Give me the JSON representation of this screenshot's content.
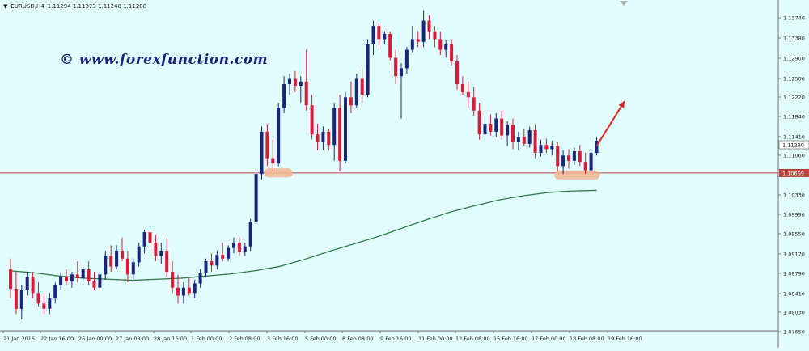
{
  "info_bar": {
    "arrow_icon": "triangle-down-icon",
    "symbol": "EURUSD,H4",
    "ohlc": "1.11294 1.11373 1.11240 1.11280"
  },
  "watermark": "© www.forexfunction.com",
  "colors": {
    "background": "#e2fdfd",
    "bull_candle": "#1a237e",
    "bear_candle": "#d81b3a",
    "moving_average": "#2e7d46",
    "support_line": "#b5453a",
    "highlight": "#f2b48f",
    "arrow": "#e52222",
    "axis": "#707070"
  },
  "chart_data": {
    "type": "candlestick",
    "symbol": "EURUSD",
    "timeframe": "H4",
    "ylim": [
      1.077,
      1.1385
    ],
    "y_ticks": [
      "1.13740",
      "1.13380",
      "1.12900",
      "1.12500",
      "1.12220",
      "1.11840",
      "1.11410",
      "1.11060",
      "1.10330",
      "1.09990",
      "1.09550",
      "1.09170",
      "1.08790",
      "1.08410",
      "1.08030",
      "1.07650"
    ],
    "x_ticks": [
      "21 Jan 2016",
      "22 Jan 16:00",
      "26 Jan 00:00",
      "27 Jan 08:00",
      "28 Jan 16:00",
      "1 Feb 00:00",
      "2 Feb 08:00",
      "3 Feb 16:00",
      "5 Feb 00:00",
      "8 Feb 08:00",
      "9 Feb 16:00",
      "11 Feb 00:00",
      "12 Feb 08:00",
      "15 Feb 16:00",
      "17 Feb 00:00",
      "18 Feb 08:00",
      "19 Feb 16:00"
    ],
    "current_price_label": "1.11280",
    "support_level": 1.10669,
    "support_label": "1.10669",
    "candles": [
      [
        1.0885,
        1.0905,
        1.083,
        1.0848
      ],
      [
        1.0848,
        1.088,
        1.08,
        1.081
      ],
      [
        1.081,
        1.0855,
        1.079,
        1.0845
      ],
      [
        1.0845,
        1.088,
        1.0835,
        1.087
      ],
      [
        1.087,
        1.088,
        1.083,
        1.084
      ],
      [
        1.084,
        1.086,
        1.0815,
        1.082
      ],
      [
        1.082,
        1.084,
        1.08,
        1.081
      ],
      [
        1.081,
        1.084,
        1.08,
        1.083
      ],
      [
        1.083,
        1.086,
        1.082,
        1.0855
      ],
      [
        1.0855,
        1.088,
        1.0845,
        1.087
      ],
      [
        1.087,
        1.0885,
        1.0855,
        1.0862
      ],
      [
        1.0862,
        1.088,
        1.085,
        1.0875
      ],
      [
        1.0875,
        1.09,
        1.086,
        1.0868
      ],
      [
        1.0868,
        1.089,
        1.086,
        1.0885
      ],
      [
        1.0885,
        1.09,
        1.0855,
        1.0862
      ],
      [
        1.0862,
        1.088,
        1.0845,
        1.085
      ],
      [
        1.085,
        1.088,
        1.0845,
        1.0875
      ],
      [
        1.0875,
        1.092,
        1.0865,
        1.091
      ],
      [
        1.091,
        1.093,
        1.088,
        1.089
      ],
      [
        1.089,
        1.093,
        1.0885,
        1.092
      ],
      [
        1.092,
        1.0945,
        1.09,
        1.0905
      ],
      [
        1.0905,
        1.092,
        1.086,
        1.0875
      ],
      [
        1.0875,
        1.0905,
        1.0865,
        1.0898
      ],
      [
        1.0898,
        1.0935,
        1.089,
        1.0928
      ],
      [
        1.0928,
        1.096,
        1.0915,
        1.0955
      ],
      [
        1.0955,
        1.0962,
        1.092,
        1.0935
      ],
      [
        1.0935,
        1.095,
        1.09,
        1.091
      ],
      [
        1.091,
        1.0935,
        1.0895,
        1.092
      ],
      [
        1.092,
        1.0945,
        1.087,
        1.088
      ],
      [
        1.088,
        1.09,
        1.084,
        1.085
      ],
      [
        1.085,
        1.0875,
        1.082,
        1.0835
      ],
      [
        1.0835,
        1.086,
        1.082,
        1.085
      ],
      [
        1.085,
        1.087,
        1.0835,
        1.084
      ],
      [
        1.084,
        1.0865,
        1.083,
        1.0858
      ],
      [
        1.0858,
        1.0885,
        1.085,
        1.0878
      ],
      [
        1.0878,
        1.0905,
        1.087,
        1.09
      ],
      [
        1.09,
        1.0915,
        1.088,
        1.0892
      ],
      [
        1.0892,
        1.092,
        1.0885,
        1.0912
      ],
      [
        1.0912,
        1.0935,
        1.09,
        1.0905
      ],
      [
        1.0905,
        1.093,
        1.09,
        1.0925
      ],
      [
        1.0925,
        1.0945,
        1.0915,
        1.0935
      ],
      [
        1.0935,
        1.0945,
        1.091,
        1.0918
      ],
      [
        1.0918,
        1.0935,
        1.091,
        1.0928
      ],
      [
        1.0928,
        1.098,
        1.092,
        1.0975
      ],
      [
        1.0975,
        1.107,
        1.097,
        1.1065
      ],
      [
        1.1065,
        1.1155,
        1.1055,
        1.1145
      ],
      [
        1.1145,
        1.116,
        1.108,
        1.1095
      ],
      [
        1.1095,
        1.113,
        1.107,
        1.1085
      ],
      [
        1.1085,
        1.12,
        1.108,
        1.119
      ],
      [
        1.119,
        1.125,
        1.118,
        1.1235
      ],
      [
        1.1235,
        1.1255,
        1.1215,
        1.1245
      ],
      [
        1.1245,
        1.126,
        1.122,
        1.1232
      ],
      [
        1.1232,
        1.125,
        1.12,
        1.124
      ],
      [
        1.124,
        1.13,
        1.1185,
        1.1195
      ],
      [
        1.1195,
        1.1215,
        1.113,
        1.114
      ],
      [
        1.114,
        1.116,
        1.111,
        1.1125
      ],
      [
        1.1125,
        1.1155,
        1.111,
        1.1145
      ],
      [
        1.1145,
        1.115,
        1.111,
        1.112
      ],
      [
        1.112,
        1.12,
        1.109,
        1.119
      ],
      [
        1.119,
        1.1215,
        1.107,
        1.109
      ],
      [
        1.109,
        1.122,
        1.1085,
        1.121
      ],
      [
        1.121,
        1.124,
        1.118,
        1.1195
      ],
      [
        1.1195,
        1.1255,
        1.119,
        1.1245
      ],
      [
        1.1245,
        1.1265,
        1.12,
        1.1215
      ],
      [
        1.1215,
        1.132,
        1.121,
        1.131
      ],
      [
        1.131,
        1.1355,
        1.129,
        1.1345
      ],
      [
        1.1345,
        1.135,
        1.1305,
        1.132
      ],
      [
        1.132,
        1.1335,
        1.131,
        1.133
      ],
      [
        1.133,
        1.1335,
        1.128,
        1.1285
      ],
      [
        1.1285,
        1.13,
        1.1235,
        1.125
      ],
      [
        1.125,
        1.1275,
        1.117,
        1.1265
      ],
      [
        1.1265,
        1.1305,
        1.1255,
        1.13
      ],
      [
        1.13,
        1.1345,
        1.1295,
        1.132
      ],
      [
        1.132,
        1.1335,
        1.1305,
        1.1315
      ],
      [
        1.1315,
        1.1375,
        1.1305,
        1.1355
      ],
      [
        1.1355,
        1.1365,
        1.132,
        1.1335
      ],
      [
        1.1335,
        1.1345,
        1.1305,
        1.132
      ],
      [
        1.132,
        1.1335,
        1.129,
        1.13
      ],
      [
        1.13,
        1.1318,
        1.1285,
        1.131
      ],
      [
        1.131,
        1.132,
        1.127,
        1.1278
      ],
      [
        1.1278,
        1.129,
        1.1225,
        1.1235
      ],
      [
        1.1235,
        1.125,
        1.1215,
        1.122
      ],
      [
        1.122,
        1.124,
        1.119,
        1.121
      ],
      [
        1.121,
        1.123,
        1.1175,
        1.1185
      ],
      [
        1.1185,
        1.12,
        1.113,
        1.114
      ],
      [
        1.114,
        1.1175,
        1.113,
        1.116
      ],
      [
        1.116,
        1.1178,
        1.1138,
        1.1145
      ],
      [
        1.1145,
        1.118,
        1.1135,
        1.117
      ],
      [
        1.117,
        1.1185,
        1.113,
        1.1138
      ],
      [
        1.1138,
        1.1165,
        1.1118,
        1.1158
      ],
      [
        1.1158,
        1.117,
        1.1112,
        1.1125
      ],
      [
        1.1125,
        1.1145,
        1.111,
        1.1135
      ],
      [
        1.1135,
        1.115,
        1.1118,
        1.1122
      ],
      [
        1.1122,
        1.1155,
        1.1115,
        1.1148
      ],
      [
        1.1148,
        1.116,
        1.1095,
        1.1105
      ],
      [
        1.1105,
        1.113,
        1.1098,
        1.112
      ],
      [
        1.112,
        1.1132,
        1.1105,
        1.1112
      ],
      [
        1.1112,
        1.1128,
        1.11,
        1.1118
      ],
      [
        1.1118,
        1.1125,
        1.107,
        1.108
      ],
      [
        1.108,
        1.111,
        1.1065,
        1.11
      ],
      [
        1.11,
        1.1112,
        1.1075,
        1.109
      ],
      [
        1.109,
        1.1115,
        1.1082,
        1.1108
      ],
      [
        1.1108,
        1.112,
        1.108,
        1.1088
      ],
      [
        1.1088,
        1.1105,
        1.1065,
        1.1072
      ],
      [
        1.1072,
        1.111,
        1.1068,
        1.1105
      ],
      [
        1.1105,
        1.1135,
        1.11,
        1.1128
      ]
    ],
    "moving_average": {
      "start_index": 0,
      "end_index": 105,
      "values": [
        1.0882,
        1.0878,
        1.0872,
        1.0868,
        1.0866,
        1.0864,
        1.0866,
        1.0868,
        1.0872,
        1.0876,
        1.0882,
        1.089,
        1.0903,
        1.0918,
        1.0932,
        1.0946,
        1.0962,
        1.0978,
        1.0993,
        1.1005,
        1.1016,
        1.1024,
        1.103,
        1.1033,
        1.1034
      ]
    },
    "annotations": [
      {
        "type": "highlight",
        "label": "support-touch-1",
        "index_start": 46,
        "index_end": 50,
        "price": 1.1068
      },
      {
        "type": "highlight",
        "label": "support-touch-2",
        "index_start": 98,
        "index_end": 105,
        "price": 1.1064
      },
      {
        "type": "arrow",
        "label": "bullish-arrow",
        "from_index": 105,
        "from_price": 1.1118,
        "to_index": 110,
        "to_price": 1.1203
      }
    ]
  }
}
